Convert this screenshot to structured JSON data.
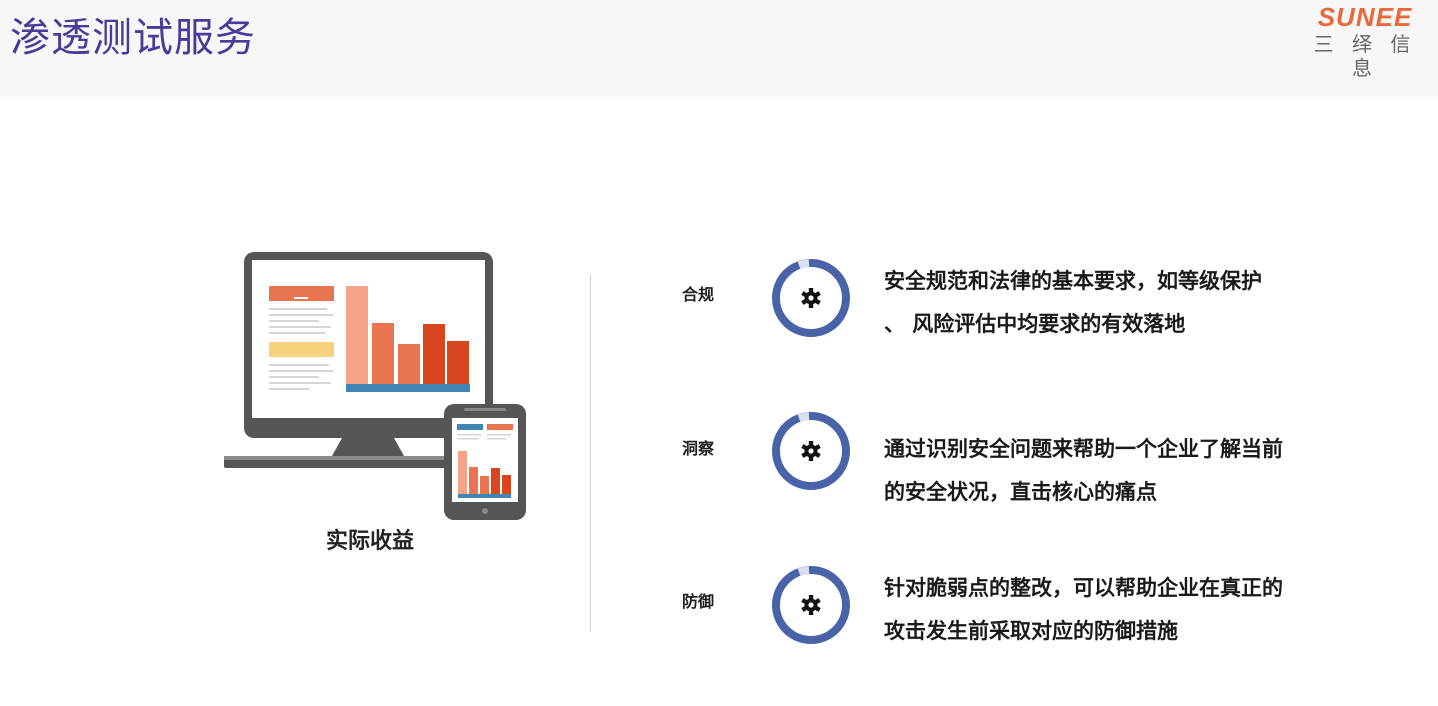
{
  "header": {
    "title": "渗透测试服务",
    "logo": {
      "mark": "SUNEE",
      "sub": "三 绎 信 息"
    }
  },
  "benefit": {
    "caption": "实际收益"
  },
  "items": [
    {
      "label": "合规",
      "icon": "gear-icon",
      "lines": [
        "安全规范和法律的基本要求，如等级保护",
        "、 风险评估中均要求的有效落地"
      ]
    },
    {
      "label": "洞察",
      "icon": "gear-icon",
      "lines": [
        "通过识别安全问题来帮助一个企业了解当前",
        "的安全状况，直击核心的痛点"
      ]
    },
    {
      "label": "防御",
      "icon": "gear-icon",
      "lines": [
        "针对脆弱点的整改，可以帮助企业在真正的",
        "攻击发生前采取对应的防御措施"
      ]
    }
  ],
  "colors": {
    "title": "#4b3a9c",
    "ring": "#4a63a8",
    "ring_gap": "#d9dff0",
    "logo": "#e86a3a",
    "bar_light": "#f6a38a",
    "bar_mid": "#e8754f",
    "bar_dark": "#d9451f",
    "chart_base": "#3f86b5",
    "yellow": "#f6d27d"
  }
}
